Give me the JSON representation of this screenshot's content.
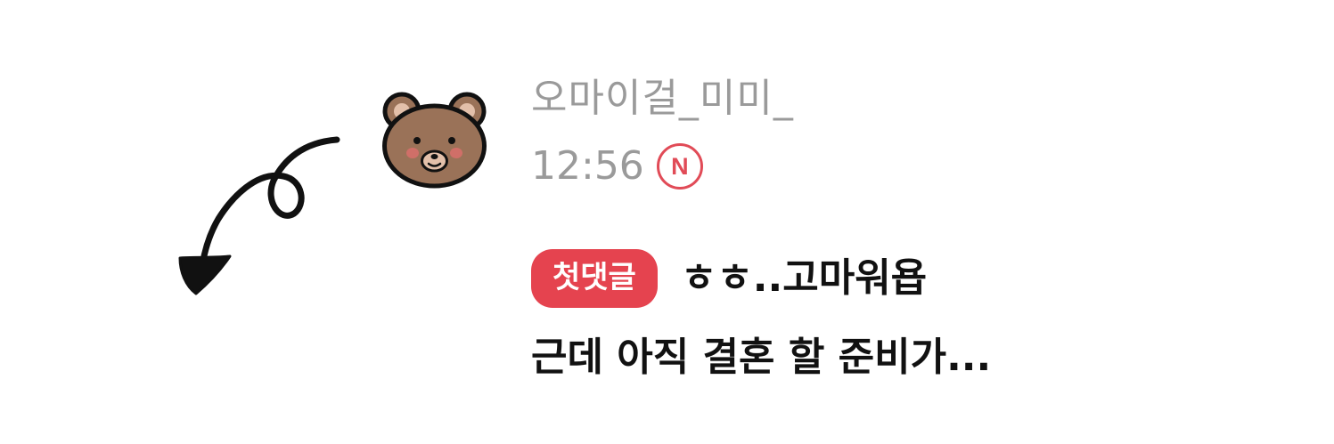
{
  "comment": {
    "author": "오마이걸_미미_",
    "time": "12:56",
    "new_badge": "N",
    "first_comment_badge": "첫댓글",
    "line1": "ㅎㅎ..고마워욥",
    "line2": "근데 아직 결혼 할 준비가..."
  },
  "colors": {
    "badge_red": "#e5434f",
    "meta_gray": "#9a9a9a",
    "text_black": "#111111"
  },
  "icons": {
    "avatar": "bear-face-icon",
    "doodle": "curly-arrow-icon"
  }
}
